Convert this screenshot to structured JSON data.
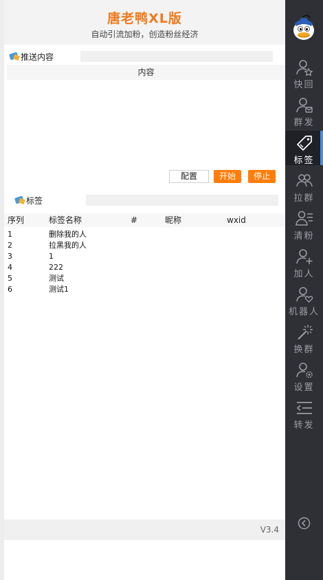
{
  "header": {
    "title": "唐老鸭XL版",
    "subtitle": "自动引流加粉，创造粉丝经济"
  },
  "push_section": {
    "label": "推送内容",
    "content_header": "内容"
  },
  "buttons": {
    "config": "配置",
    "start": "开始",
    "stop": "停止"
  },
  "tag_section": {
    "label": "标签",
    "columns": [
      "序列",
      "标签名称",
      "#",
      "昵称",
      "wxid"
    ],
    "rows": [
      {
        "index": "1",
        "name": "删除我的人"
      },
      {
        "index": "2",
        "name": "拉黑我的人"
      },
      {
        "index": "3",
        "name": "1"
      },
      {
        "index": "4",
        "name": "222"
      },
      {
        "index": "5",
        "name": "测试"
      },
      {
        "index": "6",
        "name": "测试1"
      }
    ]
  },
  "footer": {
    "version": "V3.4"
  },
  "sidebar": {
    "items": [
      {
        "label": "快回",
        "icon": "user-star-icon"
      },
      {
        "label": "群发",
        "icon": "user-mail-icon"
      },
      {
        "label": "标签",
        "icon": "tag-icon",
        "active": true
      },
      {
        "label": "拉群",
        "icon": "group-icon"
      },
      {
        "label": "清粉",
        "icon": "user-list-icon"
      },
      {
        "label": "加人",
        "icon": "user-add-icon"
      },
      {
        "label": "机器人",
        "icon": "user-heart-icon"
      },
      {
        "label": "换群",
        "icon": "wand-icon"
      },
      {
        "label": "设置",
        "icon": "user-gear-icon"
      },
      {
        "label": "转发",
        "icon": "forward-icon"
      }
    ]
  },
  "colors": {
    "accent_orange": "#f07a1c",
    "button_orange": "#ff7d0a",
    "sidebar_bg": "#2e3035",
    "active_indicator": "#4a8de0"
  }
}
